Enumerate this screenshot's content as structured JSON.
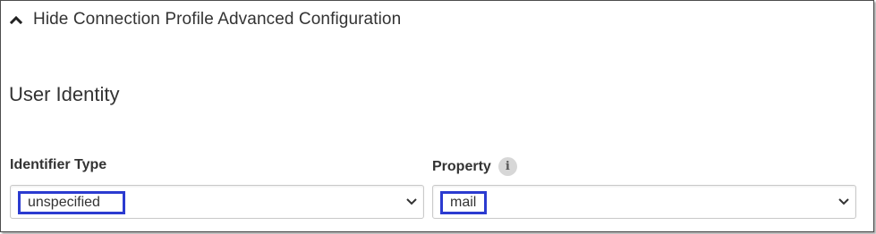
{
  "toggle": {
    "label": "Hide Connection Profile Advanced Configuration",
    "icon": "chevron-up-icon"
  },
  "section": {
    "title": "User Identity"
  },
  "fields": {
    "identifier_type": {
      "label": "Identifier Type",
      "value": "unspecified"
    },
    "property": {
      "label": "Property",
      "info": "i",
      "value": "mail"
    }
  },
  "colors": {
    "highlight": "#2b3bd0",
    "text": "#333333",
    "border": "#c9c9c9"
  }
}
